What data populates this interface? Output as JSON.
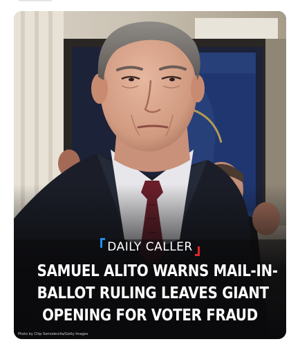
{
  "post": {
    "brand": "DAILY CALLER",
    "brand_colors": {
      "left_bracket": "#1e8ef0",
      "right_bracket": "#e0262b"
    },
    "headline_lines": [
      "SAMUEL ALITO WARNS MAIL-IN-",
      "BALLOT RULING LEAVES GIANT",
      "OPENING FOR VOTER FRAUD"
    ],
    "photo_credit": "Photo by Chip Somodevilla/Getty Images"
  }
}
